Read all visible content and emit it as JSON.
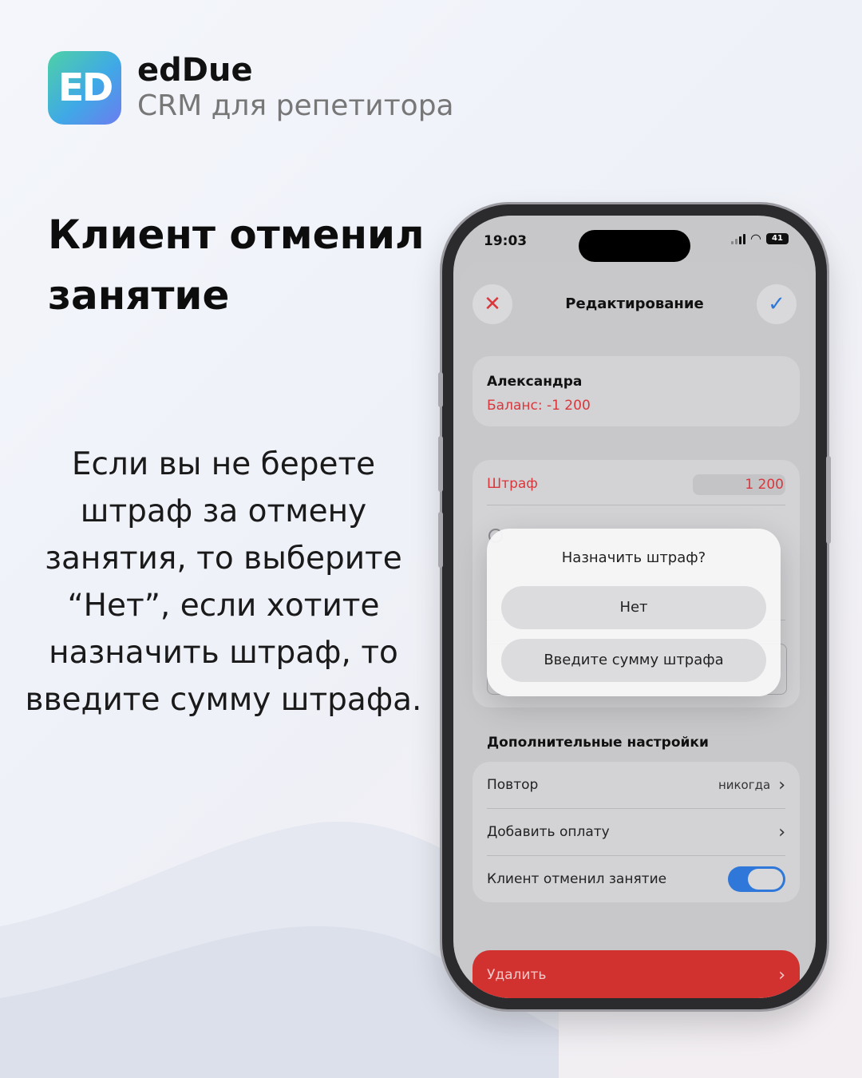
{
  "brand": {
    "logo_text": "ED",
    "name": "edDue",
    "subtitle": "CRM для репетитора"
  },
  "headline": "Клиент отменил занятие",
  "description": "Если вы не берете штраф за отмену занятия, то выберите “Нет”, если хотите назначить штраф,  то введите сумму штрафа.",
  "phone": {
    "status": {
      "time": "19:03",
      "battery": "41"
    },
    "nav": {
      "title": "Редактирование",
      "close_icon": "close-icon",
      "confirm_icon": "checkmark-icon"
    },
    "client": {
      "name": "Александра",
      "balance": "Баланс: -1 200"
    },
    "fine": {
      "label": "Штраф",
      "value": "1 200"
    },
    "dialog": {
      "title": "Назначить штраф?",
      "no_label": "Нет",
      "enter_amount_label": "Введите сумму штрафа"
    },
    "extra_settings": {
      "title": "Дополнительные настройки",
      "repeat_label": "Повтор",
      "repeat_value": "никогда",
      "add_payment_label": "Добавить оплату",
      "client_cancelled_label": "Клиент отменил занятие",
      "client_cancelled_on": true
    },
    "delete_label": "Удалить"
  },
  "colors": {
    "accent_red": "#d9373b",
    "accent_blue": "#2f77d8",
    "delete_red": "#d1312f"
  }
}
